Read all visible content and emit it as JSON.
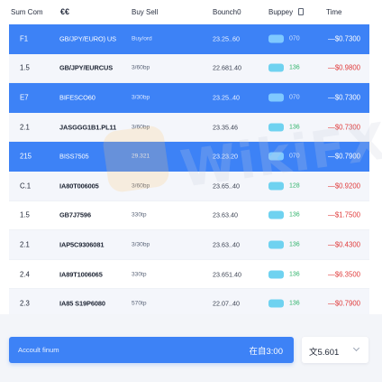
{
  "header": {
    "col_spread": "Sum Com",
    "col_pair": "€€",
    "col_buy_sell": "Buy Sell",
    "col_price": "Bounch0",
    "col_change": "Buppey",
    "col_time": "Time"
  },
  "rows": [
    {
      "spread": "F1",
      "pair": "GB/JPY/EURO) US",
      "size": "Buy/ord",
      "price": "23.25..60",
      "num": "070",
      "time": "—$0.7300",
      "selected": true
    },
    {
      "spread": "1.5",
      "pair": "GB/JPY/EURCUS",
      "size": "3/60bp",
      "price": "22.681.40",
      "num": "136",
      "time": "—$0.9800",
      "selected": false
    },
    {
      "spread": "E7",
      "pair": "BIFESCO60",
      "size": "3/30bp",
      "price": "23.25..40",
      "num": "070",
      "time": "—$0.7300",
      "selected": true
    },
    {
      "spread": "2.1",
      "pair": "JASGGG1B1.PL11",
      "size": "3/60bp",
      "price": "23.35.46",
      "num": "136",
      "time": "—$0.7300",
      "selected": false
    },
    {
      "spread": "215",
      "pair": "BISS7505",
      "size": "29.321",
      "price": "23.23.20",
      "num": "070",
      "time": "—$0.7900",
      "selected": true
    },
    {
      "spread": "C.1",
      "pair": "IA80T006005",
      "size": "3/60bp",
      "price": "23.65..40",
      "num": "128",
      "time": "—$0.9200",
      "selected": false
    },
    {
      "spread": "1.5",
      "pair": "GB7J7596",
      "size": "330tp",
      "price": "23.63.40",
      "num": "136",
      "time": "—$1.7500",
      "selected": false
    },
    {
      "spread": "2.1",
      "pair": "IAP5C9306081",
      "size": "3/30bp",
      "price": "23.63..40",
      "num": "136",
      "time": "—$0.4300",
      "selected": false
    },
    {
      "spread": "2.4",
      "pair": "IA89T1006065",
      "size": "330tp",
      "price": "23.651.40",
      "num": "136",
      "time": "—$6.3500",
      "selected": false
    },
    {
      "spread": "2.3",
      "pair": "IA85 S19P6080",
      "size": "570tp",
      "price": "22.07..40",
      "num": "136",
      "time": "—$0.7900",
      "selected": false
    }
  ],
  "watermark": {
    "text": "WikiFX"
  },
  "action": {
    "label": "Accoult finum",
    "value": "在自3:00"
  },
  "select": {
    "value": "文5.601"
  },
  "colors": {
    "accent": "#3d82f6",
    "negative": "#e03a3a",
    "positive": "#2fb36a",
    "badge": "#6fd2f0"
  }
}
